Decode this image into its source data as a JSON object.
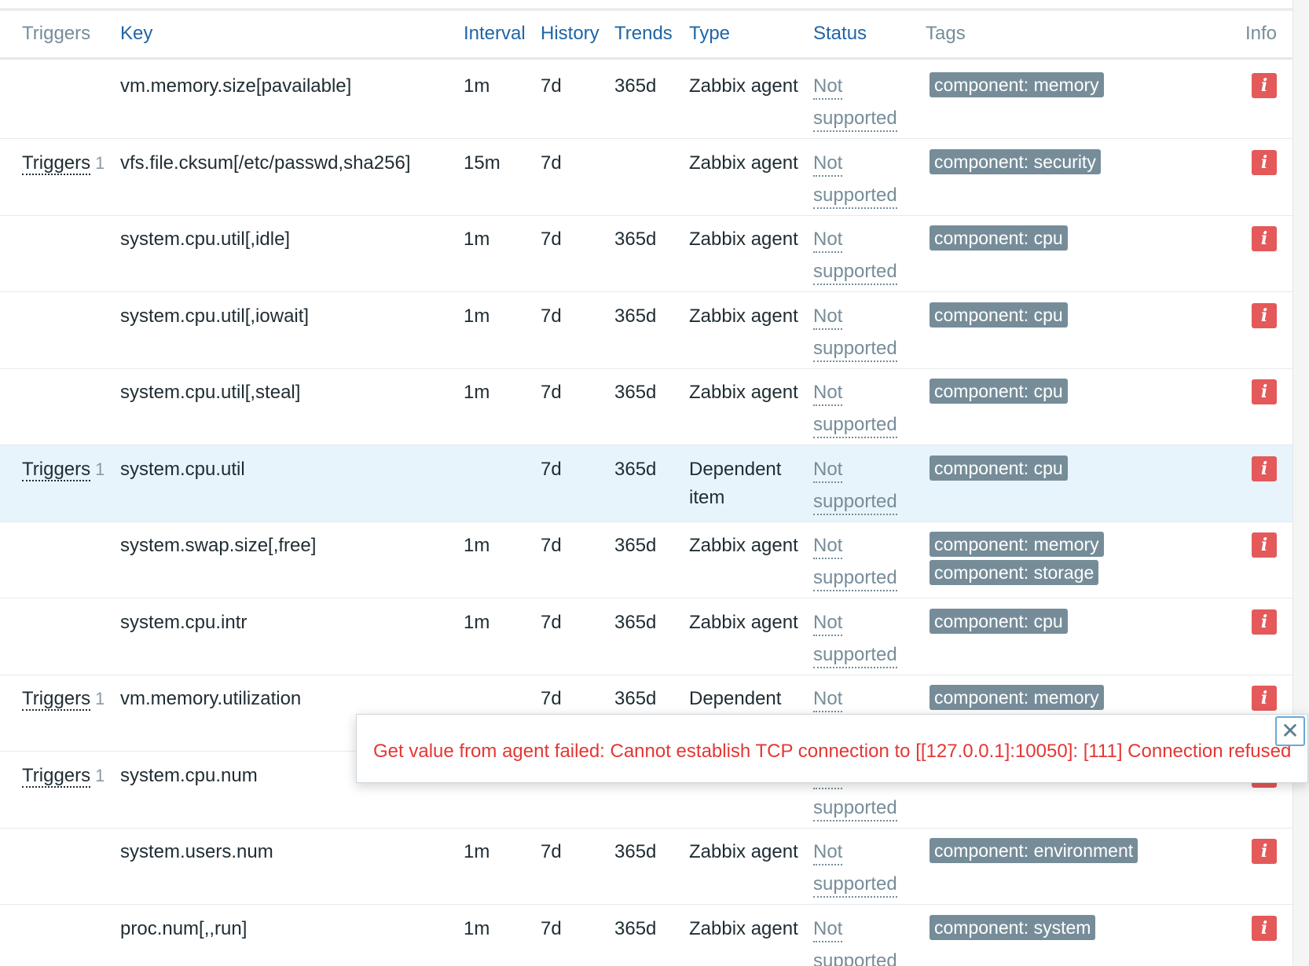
{
  "columns": {
    "triggers": "Triggers",
    "key": "Key",
    "interval": "Interval",
    "history": "History",
    "trends": "Trends",
    "type": "Type",
    "status": "Status",
    "tags": "Tags",
    "info": "Info"
  },
  "status_text": {
    "line1": "Not",
    "line2": "supported"
  },
  "trigger_link": "Triggers",
  "info_icon": "i",
  "rows": [
    {
      "trigger": "",
      "trigger_count": "",
      "key": "vm.memory.size[pavailable]",
      "interval": "1m",
      "history": "7d",
      "trends": "365d",
      "type": "Zabbix agent",
      "tags": [
        "component: memory"
      ]
    },
    {
      "trigger": "Triggers",
      "trigger_count": "1",
      "key": "vfs.file.cksum[/etc/passwd,sha256]",
      "interval": "15m",
      "history": "7d",
      "trends": "",
      "type": "Zabbix agent",
      "tags": [
        "component: security"
      ]
    },
    {
      "trigger": "",
      "trigger_count": "",
      "key": "system.cpu.util[,idle]",
      "interval": "1m",
      "history": "7d",
      "trends": "365d",
      "type": "Zabbix agent",
      "tags": [
        "component: cpu"
      ]
    },
    {
      "trigger": "",
      "trigger_count": "",
      "key": "system.cpu.util[,iowait]",
      "interval": "1m",
      "history": "7d",
      "trends": "365d",
      "type": "Zabbix agent",
      "tags": [
        "component: cpu"
      ]
    },
    {
      "trigger": "",
      "trigger_count": "",
      "key": "system.cpu.util[,steal]",
      "interval": "1m",
      "history": "7d",
      "trends": "365d",
      "type": "Zabbix agent",
      "tags": [
        "component: cpu"
      ]
    },
    {
      "trigger": "Triggers",
      "trigger_count": "1",
      "key": "system.cpu.util",
      "interval": "",
      "history": "7d",
      "trends": "365d",
      "type": "Dependent item",
      "tags": [
        "component: cpu"
      ],
      "highlighted": true
    },
    {
      "trigger": "",
      "trigger_count": "",
      "key": "system.swap.size[,free]",
      "interval": "1m",
      "history": "7d",
      "trends": "365d",
      "type": "Zabbix agent",
      "tags": [
        "component: memory",
        "component: storage"
      ]
    },
    {
      "trigger": "",
      "trigger_count": "",
      "key": "system.cpu.intr",
      "interval": "1m",
      "history": "7d",
      "trends": "365d",
      "type": "Zabbix agent",
      "tags": [
        "component: cpu"
      ]
    },
    {
      "trigger": "Triggers",
      "trigger_count": "1",
      "key": "vm.memory.utilization",
      "interval": "",
      "history": "7d",
      "trends": "365d",
      "type": "Dependent",
      "tags": [
        "component: memory"
      ]
    },
    {
      "trigger": "Triggers",
      "trigger_count": "1",
      "key": "system.cpu.num",
      "interval": "",
      "history": "",
      "trends": "",
      "type": "",
      "tags": []
    },
    {
      "trigger": "",
      "trigger_count": "",
      "key": "system.users.num",
      "interval": "1m",
      "history": "7d",
      "trends": "365d",
      "type": "Zabbix agent",
      "tags": [
        "component: environment"
      ]
    },
    {
      "trigger": "",
      "trigger_count": "",
      "key": "proc.num[,,run]",
      "interval": "1m",
      "history": "7d",
      "trends": "365d",
      "type": "Zabbix agent",
      "tags": [
        "component: system"
      ]
    }
  ],
  "popup": {
    "message": "Get value from agent failed: Cannot establish TCP connection to [[127.0.0.1]:10050]: [111] Connection refused",
    "close_icon": "✕"
  },
  "colors": {
    "link": "#1f65a7",
    "tag_bg": "#768d99",
    "info_red": "#e45959",
    "error_text": "#e33734",
    "row_highlight": "#e8f4fb"
  }
}
